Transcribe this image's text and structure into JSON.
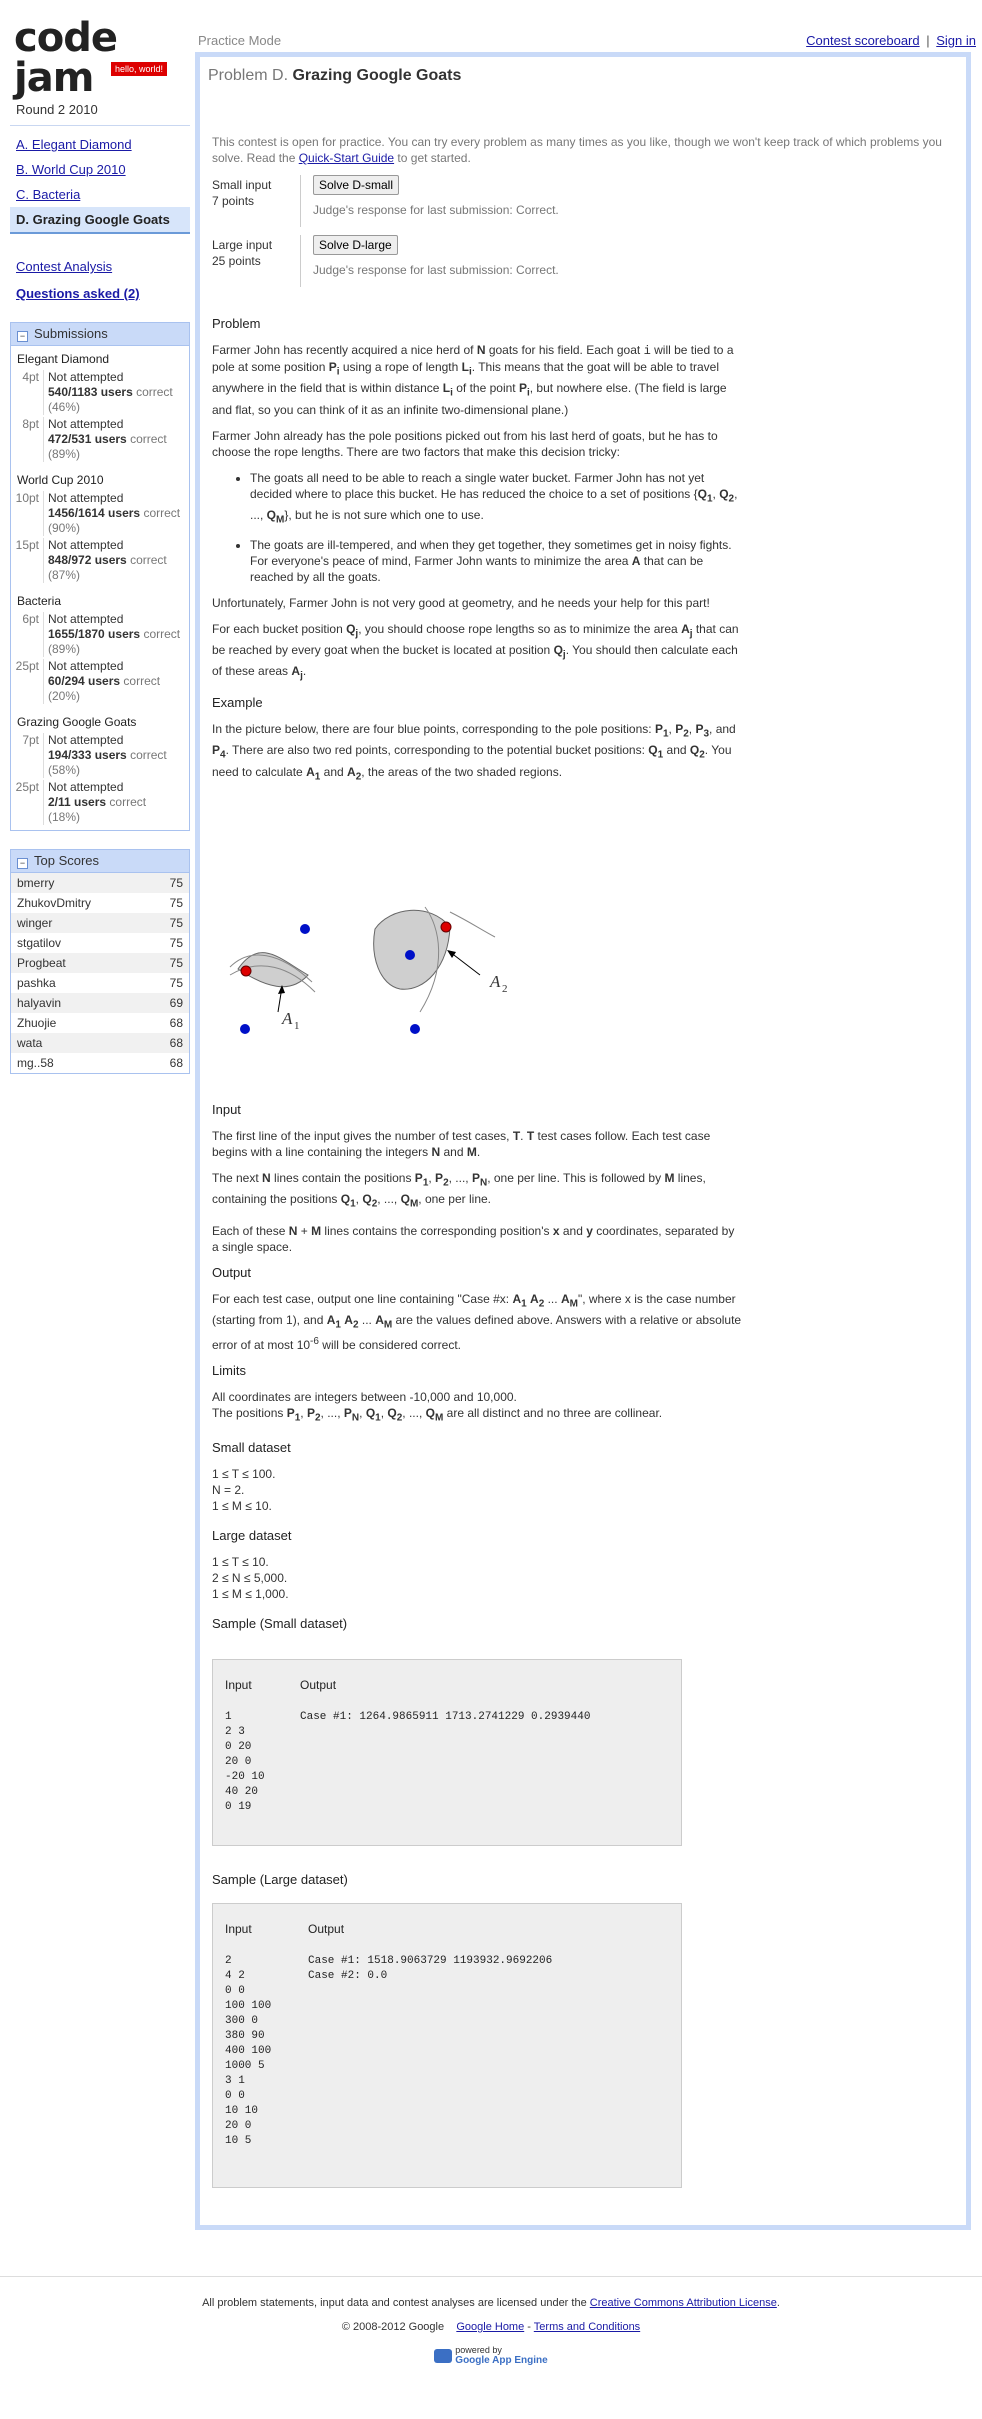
{
  "logo": {
    "title": "code jam",
    "tag": "hello, world!"
  },
  "mode": "Practice Mode",
  "toplinks": {
    "scoreboard": "Contest scoreboard",
    "sep": "|",
    "signin": "Sign in"
  },
  "round": "Round 2 2010",
  "problems": [
    "A. Elegant Diamond",
    "B. World Cup 2010",
    "C. Bacteria",
    "D. Grazing Google Goats"
  ],
  "links": {
    "analysis": "Contest Analysis",
    "questions": "Questions asked (2)"
  },
  "submissions": {
    "title": "Submissions",
    "problems": [
      {
        "name": "Elegant Diamond",
        "rows": [
          {
            "pt": "4pt",
            "status": "Not attempted",
            "users": "540/1183 users",
            "correct": "correct",
            "pct": "(46%)"
          },
          {
            "pt": "8pt",
            "status": "Not attempted",
            "users": "472/531 users",
            "correct": "correct",
            "pct": "(89%)"
          }
        ]
      },
      {
        "name": "World Cup 2010",
        "rows": [
          {
            "pt": "10pt",
            "status": "Not attempted",
            "users": "1456/1614 users",
            "correct": "correct (90%)",
            "pct": ""
          },
          {
            "pt": "15pt",
            "status": "Not attempted",
            "users": "848/972 users",
            "correct": "correct",
            "pct": "(87%)"
          }
        ]
      },
      {
        "name": "Bacteria",
        "rows": [
          {
            "pt": "6pt",
            "status": "Not attempted",
            "users": "1655/1870 users",
            "correct": "correct (89%)",
            "pct": ""
          },
          {
            "pt": "25pt",
            "status": "Not attempted",
            "users": "60/294 users",
            "correct": "correct",
            "pct": "(20%)"
          }
        ]
      },
      {
        "name": "Grazing Google Goats",
        "rows": [
          {
            "pt": "7pt",
            "status": "Not attempted",
            "users": "194/333 users",
            "correct": "correct",
            "pct": "(58%)"
          },
          {
            "pt": "25pt",
            "status": "Not attempted",
            "users": "2/11 users",
            "correct": "correct",
            "pct": "(18%)"
          }
        ]
      }
    ]
  },
  "topscores": {
    "title": "Top Scores",
    "rows": [
      [
        "bmerry",
        "75"
      ],
      [
        "ZhukovDmitry",
        "75"
      ],
      [
        "winger",
        "75"
      ],
      [
        "stgatilov",
        "75"
      ],
      [
        "Progbeat",
        "75"
      ],
      [
        "pashka",
        "75"
      ],
      [
        "halyavin",
        "69"
      ],
      [
        "Zhuojie",
        "68"
      ],
      [
        "wata",
        "68"
      ],
      [
        "mg..58",
        "68"
      ]
    ]
  },
  "problem": {
    "prefix": "Problem D.",
    "title": "Grazing Google Goats"
  },
  "practice": {
    "before": "This contest is open for practice. You can try every problem as many times as you like, though we won't keep track of which problems you solve. Read the ",
    "link": "Quick-Start Guide",
    "after": " to get started."
  },
  "small": {
    "label1": "Small input",
    "label2": "7 points",
    "button": "Solve D-small",
    "resp": "Judge's response for last submission: Correct."
  },
  "large": {
    "label1": "Large input",
    "label2": "25 points",
    "button": "Solve D-large",
    "resp": "Judge's response for last submission: Correct."
  },
  "h_problem": "Problem",
  "h_example": "Example",
  "h_input": "Input",
  "h_output": "Output",
  "h_limits": "Limits",
  "h_small": "Small dataset",
  "h_large": "Large dataset",
  "h_samp_small": "Sample (Small dataset)",
  "h_samp_large": "Sample (Large dataset)",
  "small_ds": [
    "1 ≤ T ≤ 100.",
    "N = 2.",
    "1 ≤ M ≤ 10."
  ],
  "large_ds": [
    "1 ≤ T ≤ 10.",
    "2 ≤ N ≤ 5,000.",
    "1 ≤ M ≤ 1,000."
  ],
  "limits": {
    "l1": "All coordinates are integers between -10,000 and 10,000."
  },
  "figure": {
    "a1": "A",
    "a2": "A",
    "s1": "1",
    "s2": "2"
  },
  "samples": {
    "col_input": "Input",
    "col_output": "Output",
    "small_in": "1\n2 3\n0 20\n20 0\n-20 10\n40 20\n0 19",
    "small_out": "Case #1: 1264.9865911 1713.2741229 0.2939440",
    "large_in": "2\n4 2\n0 0\n100 100\n300 0\n380 90\n400 100\n1000 5\n3 1\n0 0\n10 10\n20 0\n10 5",
    "large_out": "Case #1: 1518.9063729 1193932.9692206\nCase #2: 0.0"
  },
  "footer": {
    "license_before": "All problem statements, input data and contest analyses are licensed under the ",
    "license_link": "Creative Commons Attribution License",
    "license_after": ".",
    "copy": "© 2008-2012 Google",
    "home": "Google Home",
    "terms": "Terms and Conditions",
    "powered": "powered by",
    "gae": "Google App Engine"
  }
}
